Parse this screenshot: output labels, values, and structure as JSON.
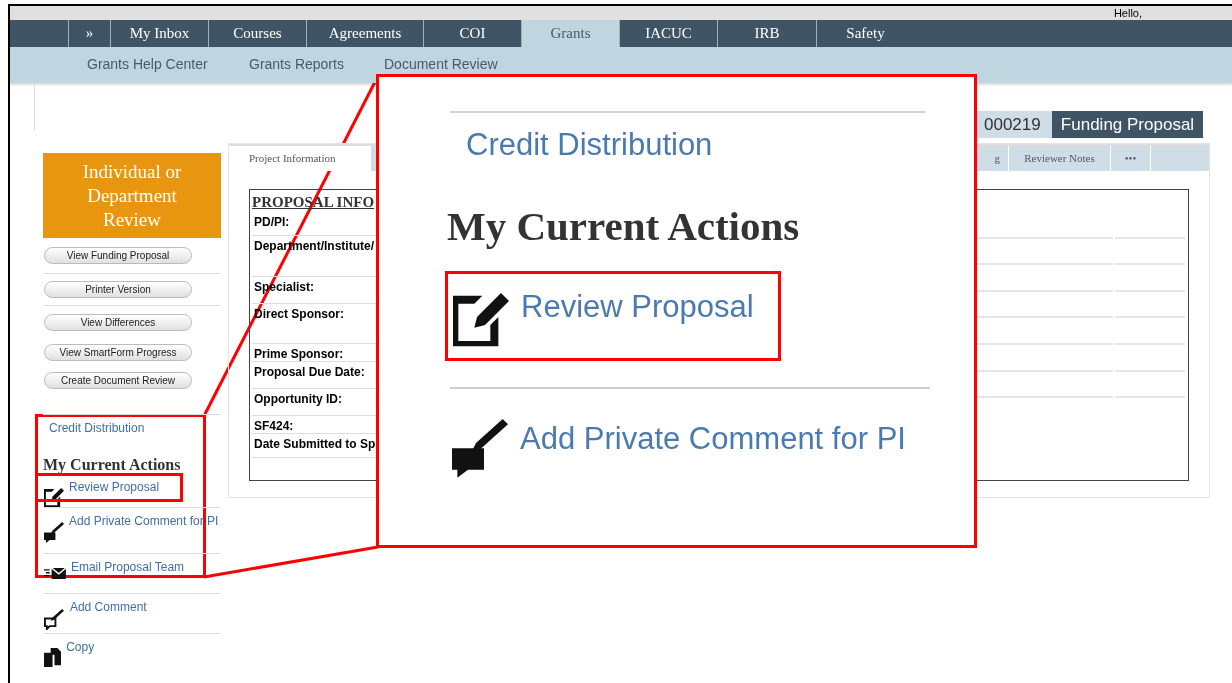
{
  "header": {
    "greeting": "Hello,"
  },
  "nav_tabs": [
    {
      "label": "»",
      "selected": false
    },
    {
      "label": "My Inbox",
      "selected": false
    },
    {
      "label": "Courses",
      "selected": false
    },
    {
      "label": "Agreements",
      "selected": false
    },
    {
      "label": "COI",
      "selected": false
    },
    {
      "label": "Grants",
      "selected": true
    },
    {
      "label": "IACUC",
      "selected": false
    },
    {
      "label": "IRB",
      "selected": false
    },
    {
      "label": "Safety",
      "selected": false
    }
  ],
  "subnav": [
    "Grants Help Center",
    "Grants Reports",
    "Document Review"
  ],
  "record": {
    "id": "000219",
    "type": "Funding Proposal"
  },
  "sidebar": {
    "status": "Individual or Department Review",
    "buttons": [
      "View Funding Proposal",
      "Printer Version",
      "View Differences",
      "View SmartForm Progress",
      "Create Document Review"
    ],
    "link": "Credit Distribution",
    "actions_heading": "My Current Actions",
    "actions": [
      {
        "label": "Review Proposal",
        "kind": "edit",
        "highlighted": true
      },
      {
        "label": "Add Private Comment for PI",
        "kind": "private-comment",
        "highlighted": false
      },
      {
        "label": "Email Proposal Team",
        "kind": "email",
        "highlighted": false
      },
      {
        "label": "Add Comment",
        "kind": "comment",
        "highlighted": false
      },
      {
        "label": "Copy",
        "kind": "copy",
        "highlighted": false
      }
    ]
  },
  "content_tabs": [
    {
      "label": "Project Information",
      "selected": true
    },
    {
      "label": "g",
      "selected": false
    },
    {
      "label": "Reviewer Notes",
      "selected": false
    },
    {
      "label": "•••",
      "selected": false
    }
  ],
  "proposal_info": {
    "title": "PROPOSAL INFO",
    "fields": [
      "PD/PI:",
      "Department/Institute/",
      "Specialist:",
      "Direct Sponsor:",
      "Prime Sponsor:",
      "Proposal Due Date:",
      "Opportunity ID:",
      "SF424:",
      "Date Submitted to Sp"
    ]
  },
  "callout": {
    "link": "Credit Distribution",
    "heading": "My Current Actions",
    "actions": [
      {
        "label": "Review Proposal",
        "kind": "edit",
        "highlighted": true
      },
      {
        "label": "Add Private Comment for PI",
        "kind": "private-comment",
        "highlighted": false
      }
    ]
  }
}
